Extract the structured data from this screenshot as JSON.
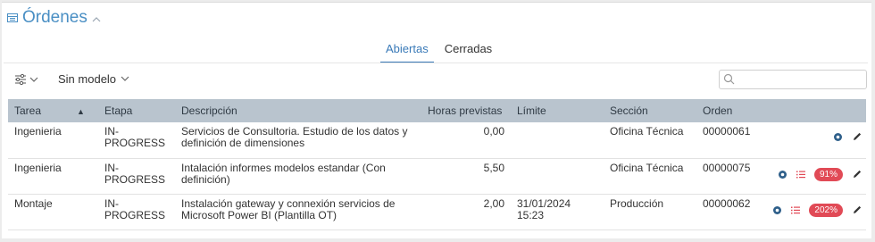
{
  "header": {
    "title": "Órdenes"
  },
  "tabs": [
    {
      "label": "Abiertas",
      "active": true
    },
    {
      "label": "Cerradas",
      "active": false
    }
  ],
  "toolbar": {
    "model_label": "Sin modelo",
    "search_placeholder": ""
  },
  "table": {
    "columns": [
      "Tarea",
      "Etapa",
      "Descripción",
      "Horas previstas",
      "Límite",
      "Sección",
      "Orden"
    ],
    "rows": [
      {
        "tarea": "Ingenieria",
        "etapa": "IN-PROGRESS",
        "descripcion": "Servicios de Consultoria. Estudio de los datos y definición de dimensiones",
        "horas": "0,00",
        "limite": "",
        "seccion": "Oficina Técnica",
        "orden": "00000061",
        "badge": ""
      },
      {
        "tarea": "Ingenieria",
        "etapa": "IN-PROGRESS",
        "descripcion": "Intalación informes modelos estandar (Con definición)",
        "horas": "5,50",
        "limite": "",
        "seccion": "Oficina Técnica",
        "orden": "00000075",
        "badge": "91%"
      },
      {
        "tarea": "Montaje",
        "etapa": "IN-PROGRESS",
        "descripcion": "Instalación gateway y connexión servicios de Microsoft Power BI (Plantilla OT)",
        "horas": "2,00",
        "limite": "31/01/2024 15:23",
        "seccion": "Producción",
        "orden": "00000062",
        "badge": "202%"
      }
    ]
  },
  "colors": {
    "accent": "#3a7ab8",
    "header_bg": "#b9c4ce",
    "badge_bg": "#e14a56",
    "icon_blue": "#2e5f8a"
  }
}
